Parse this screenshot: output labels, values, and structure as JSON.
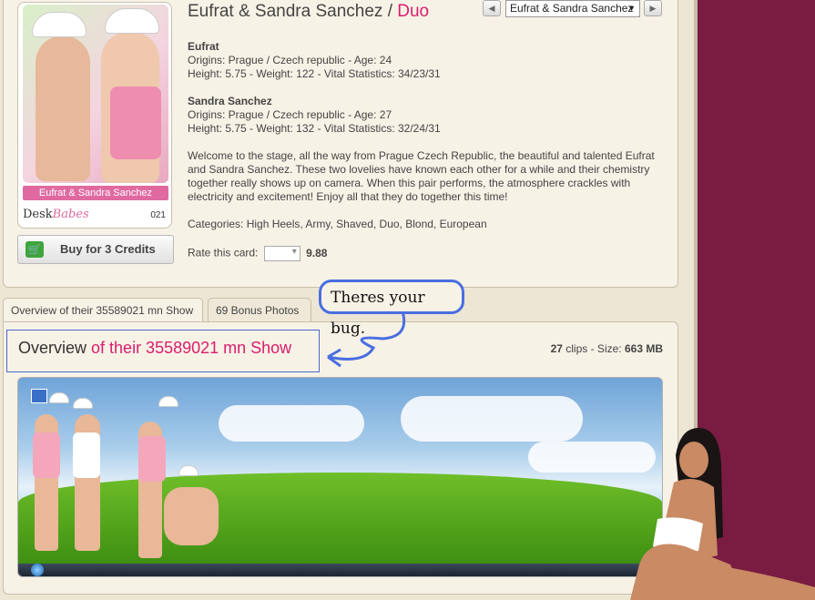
{
  "profile": {
    "title_main": "Eufrat & Sandra Sanchez",
    "title_sep": "/",
    "title_accent": "Duo",
    "nav_select_value": "Eufrat & Sandra Sanchez",
    "card": {
      "name": "Eufrat & Sandra Sanchez",
      "brand_left": "Desk",
      "brand_right": "Babes",
      "number": "021"
    },
    "buy_label": "Buy for 3 Credits",
    "model1": {
      "name": "Eufrat",
      "origins": "Origins: Prague / Czech republic - Age: 24",
      "stats": "Height: 5.75 - Weight: 122 - Vital Statistics: 34/23/31"
    },
    "model2": {
      "name": "Sandra Sanchez",
      "origins": "Origins: Prague / Czech republic - Age: 27",
      "stats": "Height: 5.75 - Weight: 132 - Vital Statistics: 32/24/31"
    },
    "description": "Welcome to the stage, all the way from Prague Czech Republic, the beautiful and talented Eufrat and Sandra Sanchez. These two lovelies have known each other for a while and their chemistry together really shows up on camera. When this pair performs, the atmosphere crackles with electricity and excitement! Enjoy all that they do together this time!",
    "categories": "Categories: High Heels, Army, Shaved, Duo, Blond, European",
    "rate_label": "Rate this card:",
    "rating": "9.88"
  },
  "tabs": [
    {
      "label": "Overview of their 35589021 mn Show"
    },
    {
      "label": "69 Bonus Photos"
    }
  ],
  "overview": {
    "title_plain": "Overview",
    "title_accent": "of their 35589021 mn Show",
    "clips_count": "27",
    "clips_text": "clips - Size:",
    "size": "663 MB"
  },
  "annotation": {
    "text": "Theres your bug."
  },
  "colors": {
    "accent": "#d81d6e",
    "sidebar": "#7a1c42",
    "panel": "#f7f2e6",
    "annotation": "#4a6ee0"
  }
}
